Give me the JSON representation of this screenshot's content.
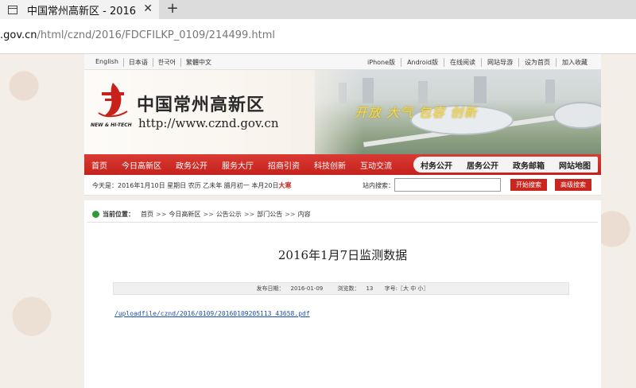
{
  "browser": {
    "tab_title": "中国常州高新区 - 2016",
    "close_glyph": "✕",
    "new_tab_glyph": "+",
    "url_host": ".gov.cn",
    "url_path": "/html/cznd/2016/FDCFILKP_0109/214499.html"
  },
  "topnav": {
    "languages": [
      "English",
      "日本语",
      "한국어",
      "繁體中文"
    ],
    "utilities": [
      "iPhone版",
      "Android版",
      "在线阅读",
      "网站导游",
      "设为首页",
      "加入收藏"
    ]
  },
  "banner": {
    "logo_sub": "NEW & HI-TECH",
    "site_name": "中国常州高新区",
    "site_url": "http://www.cznd.gov.cn",
    "slogan": "开放 大气 包容 创新"
  },
  "mainnav": {
    "items": [
      "首页",
      "今日高新区",
      "政务公开",
      "服务大厅",
      "招商引资",
      "科技创新",
      "互动交流"
    ],
    "right_items": [
      "村务公开",
      "居务公开",
      "政务邮箱",
      "网站地图"
    ]
  },
  "infobar": {
    "date_text": "今天是：2016年1月10日 星期日 农历 乙未年 腊月初一 本月20日",
    "date_highlight": "大寒",
    "search_label": "站内搜索：",
    "search_value": "",
    "search_button": "开始搜索",
    "advanced_button": "高级搜索"
  },
  "breadcrumb": {
    "label": "当前位置：",
    "items": [
      "首页",
      "今日高新区",
      "公告公示",
      "部门公告",
      "内容"
    ],
    "separator": ">>"
  },
  "article": {
    "title": "2016年1月7日监测数据",
    "publish_label": "发布日期：",
    "publish_date": "2016-01-09",
    "views_label": "浏览数：",
    "views": "13",
    "font_size_text": "字号:〖大 中 小〗",
    "attachment": "/uploadfile/cznd/2016/0109/20160109205113_43658.pdf"
  },
  "colors": {
    "nav_red": "#c5221d",
    "link_blue": "#1a4fb0",
    "slogan_gold": "#f2dc54"
  }
}
